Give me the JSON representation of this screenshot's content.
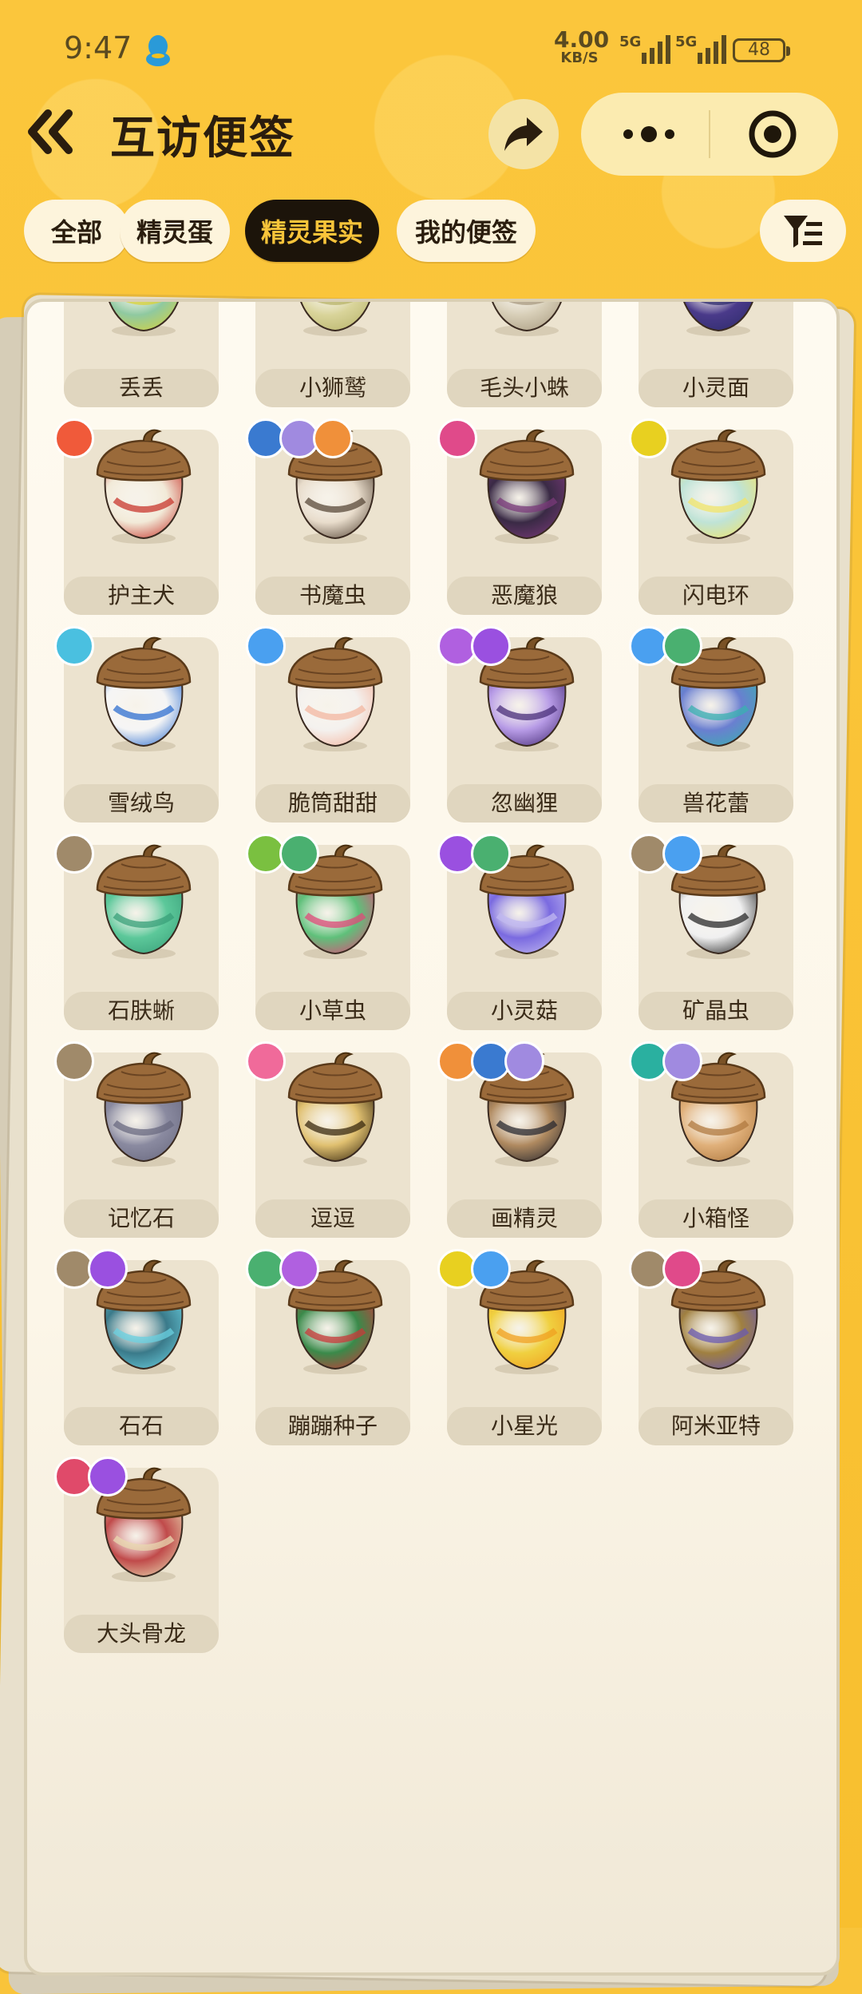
{
  "status_bar": {
    "time": "9:47",
    "net_speed_value": "4.00",
    "net_speed_unit": "KB/S",
    "signal_1": "5G",
    "signal_2": "5G",
    "battery": "48"
  },
  "header": {
    "title": "互访便签"
  },
  "tabs": [
    {
      "label": "全部",
      "active": false
    },
    {
      "label": "精灵蛋",
      "active": false
    },
    {
      "label": "精灵果实",
      "active": true
    },
    {
      "label": "我的便签",
      "active": false
    }
  ],
  "items": [
    {
      "name": "丢丢",
      "body": "#8fc9a0",
      "accent": "#d9d23a",
      "badges": []
    },
    {
      "name": "小狮鹫",
      "body": "#d9d49a",
      "accent": "#b7b36a",
      "badges": []
    },
    {
      "name": "毛头小蛛",
      "body": "#d8cfb8",
      "accent": "#a89a80",
      "badges": []
    },
    {
      "name": "小灵面",
      "body": "#4a3a8a",
      "accent": "#2d2b6b",
      "badges": []
    },
    {
      "name": "护主犬",
      "body": "#f2ead8",
      "accent": "#c8372d",
      "badges": [
        "fire"
      ]
    },
    {
      "name": "书魔虫",
      "body": "#e8dccb",
      "accent": "#5a4a3a",
      "badges": [
        "light",
        "illusion",
        "mech"
      ]
    },
    {
      "name": "恶魔狼",
      "body": "#3a2a45",
      "accent": "#7a3a7a",
      "badges": [
        "demon"
      ]
    },
    {
      "name": "闪电环",
      "body": "#bfe3d6",
      "accent": "#f1e46a",
      "badges": [
        "electric"
      ]
    },
    {
      "name": "雪绒鸟",
      "body": "#f5f5f5",
      "accent": "#2f6fd0",
      "badges": [
        "wing"
      ]
    },
    {
      "name": "脆筒甜甜",
      "body": "#f4f1ee",
      "accent": "#f3b7a0",
      "badges": [
        "ice"
      ]
    },
    {
      "name": "忽幽狸",
      "body": "#b79be6",
      "accent": "#4a2f7a",
      "badges": [
        "poison",
        "ghost"
      ]
    },
    {
      "name": "兽花蕾",
      "body": "#6a7fd0",
      "accent": "#3ab0b0",
      "badges": [
        "ice",
        "grass"
      ]
    },
    {
      "name": "石肤蜥",
      "body": "#5cc89a",
      "accent": "#3aa07a",
      "badges": [
        "ground"
      ]
    },
    {
      "name": "小草虫",
      "body": "#5fc07a",
      "accent": "#e04a7a",
      "badges": [
        "bug",
        "grass"
      ]
    },
    {
      "name": "小灵菇",
      "body": "#7a6ae0",
      "accent": "#c0b8f0",
      "badges": [
        "ghost",
        "grass"
      ]
    },
    {
      "name": "矿晶虫",
      "body": "#f0f0f0",
      "accent": "#2a2a2a",
      "badges": [
        "ground",
        "ice"
      ]
    },
    {
      "name": "记忆石",
      "body": "#8a8aa0",
      "accent": "#6a6a80",
      "badges": [
        "ground"
      ]
    },
    {
      "name": "逗逗",
      "body": "#e0c070",
      "accent": "#3a2a10",
      "badges": [
        "cute"
      ]
    },
    {
      "name": "画精灵",
      "body": "#b08a60",
      "accent": "#2a2a30",
      "badges": [
        "mech",
        "light",
        "illusion"
      ]
    },
    {
      "name": "小箱怪",
      "body": "#e0b07a",
      "accent": "#b07a40",
      "badges": [
        "gear",
        "illusion"
      ]
    },
    {
      "name": "石石",
      "body": "#3a7a8a",
      "accent": "#6ad0e0",
      "badges": [
        "ground",
        "ghost"
      ]
    },
    {
      "name": "蹦蹦种子",
      "body": "#3a8a4a",
      "accent": "#c83a3a",
      "badges": [
        "grass",
        "poison"
      ]
    },
    {
      "name": "小星光",
      "body": "#f0d040",
      "accent": "#f0a020",
      "badges": [
        "electric",
        "ice"
      ]
    },
    {
      "name": "阿米亚特",
      "body": "#a08040",
      "accent": "#6a5ab0",
      "badges": [
        "ground",
        "demon"
      ]
    },
    {
      "name": "大头骨龙",
      "body": "#c04a4a",
      "accent": "#e8d8b0",
      "badges": [
        "dragon",
        "ghost"
      ]
    }
  ],
  "badge_colors": {
    "fire": "#f05a3a",
    "light": "#3a7ad0",
    "illusion": "#a08ae0",
    "mech": "#f0903a",
    "demon": "#e04a8a",
    "electric": "#e8d020",
    "wing": "#4ac0e0",
    "ice": "#4aa0f0",
    "poison": "#b060e0",
    "ghost": "#9a50e0",
    "grass": "#4ab070",
    "ground": "#a08a6a",
    "bug": "#7ac040",
    "cute": "#f06a9a",
    "gear": "#2ab0a0",
    "dragon": "#e04a6a"
  },
  "badge_glyphs": {
    "fire": "flame-icon",
    "light": "star-icon",
    "illusion": "spiral-icon",
    "mech": "crown-icon",
    "demon": "demon-icon",
    "electric": "bolt-icon",
    "wing": "wing-icon",
    "ice": "snowflake-icon",
    "poison": "bubble-icon",
    "ghost": "ghost-icon",
    "grass": "leaf-icon",
    "ground": "mountain-icon",
    "bug": "bug-icon",
    "cute": "heart-icon",
    "gear": "gear-icon",
    "dragon": "dragon-icon"
  }
}
